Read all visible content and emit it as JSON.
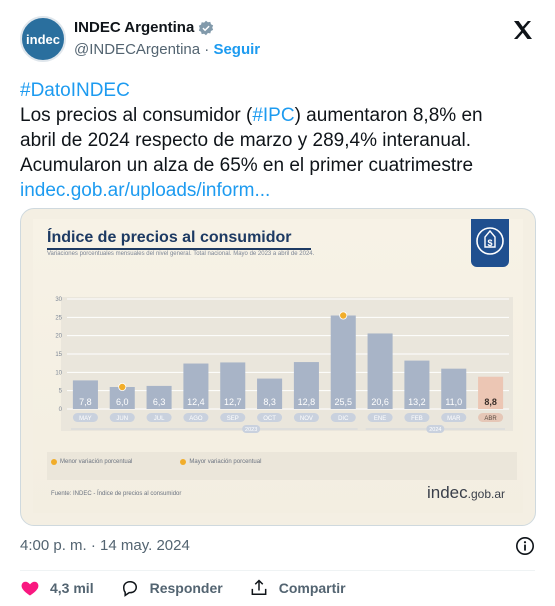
{
  "account": {
    "avatar_text": "indec",
    "display_name": "INDEC Argentina",
    "handle": "@INDECArgentina",
    "separator": " · ",
    "follow_label": "Seguir"
  },
  "tweet": {
    "line1": "#DatoINDEC",
    "line2_pre": "Los precios al consumidor (",
    "line2_tag": "#IPC",
    "line2_post": ") aumentaron 8,8% en",
    "line3": "abril de 2024 respecto de marzo y 289,4% interanual.",
    "line4": "Acumularon un alza de 65% en el primer cuatrimestre",
    "link": "indec.gob.ar/uploads/inform..."
  },
  "meta": {
    "time": "4:00 p. m. · 14 may. 2024"
  },
  "actions": {
    "like_count": "4,3 mil",
    "reply_label": "Responder",
    "share_label": "Compartir"
  },
  "colors": {
    "accent": "#1d9bf0",
    "bar": "#a8b4c7",
    "bar_last": "#ecc6b4",
    "marker": "#f1ad2a"
  },
  "chart_data": {
    "type": "bar",
    "title": "Índice de precios al consumidor",
    "subtitle": "Variaciones porcentuales mensuales del nivel general. Total nacional. Mayo de 2023 a abril de 2024.",
    "categories": [
      "MAY",
      "JUN",
      "JUL",
      "AGO",
      "SEP",
      "OCT",
      "NOV",
      "DIC",
      "ENE",
      "FEB",
      "MAR",
      "ABR"
    ],
    "values": [
      7.8,
      6.0,
      6.3,
      12.4,
      12.7,
      8.3,
      12.8,
      25.5,
      20.6,
      13.2,
      11.0,
      8.8
    ],
    "value_labels": [
      "7,8",
      "6,0",
      "6,3",
      "12,4",
      "12,7",
      "8,3",
      "12,8",
      "25,5",
      "20,6",
      "13,2",
      "11,0",
      "8,8"
    ],
    "yticks": [
      0,
      5,
      10,
      15,
      20,
      25,
      30
    ],
    "ylim": [
      0,
      30
    ],
    "year_labels": [
      "2023",
      "2024"
    ],
    "markers": {
      "min_index": 1,
      "max_index": 7
    },
    "legend": [
      "Menor variación porcentual",
      "Mayor variación porcentual"
    ],
    "source": "Fuente: INDEC - Índice de precios al consumidor",
    "brand": "indec",
    "brand_suffix": ".gob.ar",
    "grid": true
  }
}
